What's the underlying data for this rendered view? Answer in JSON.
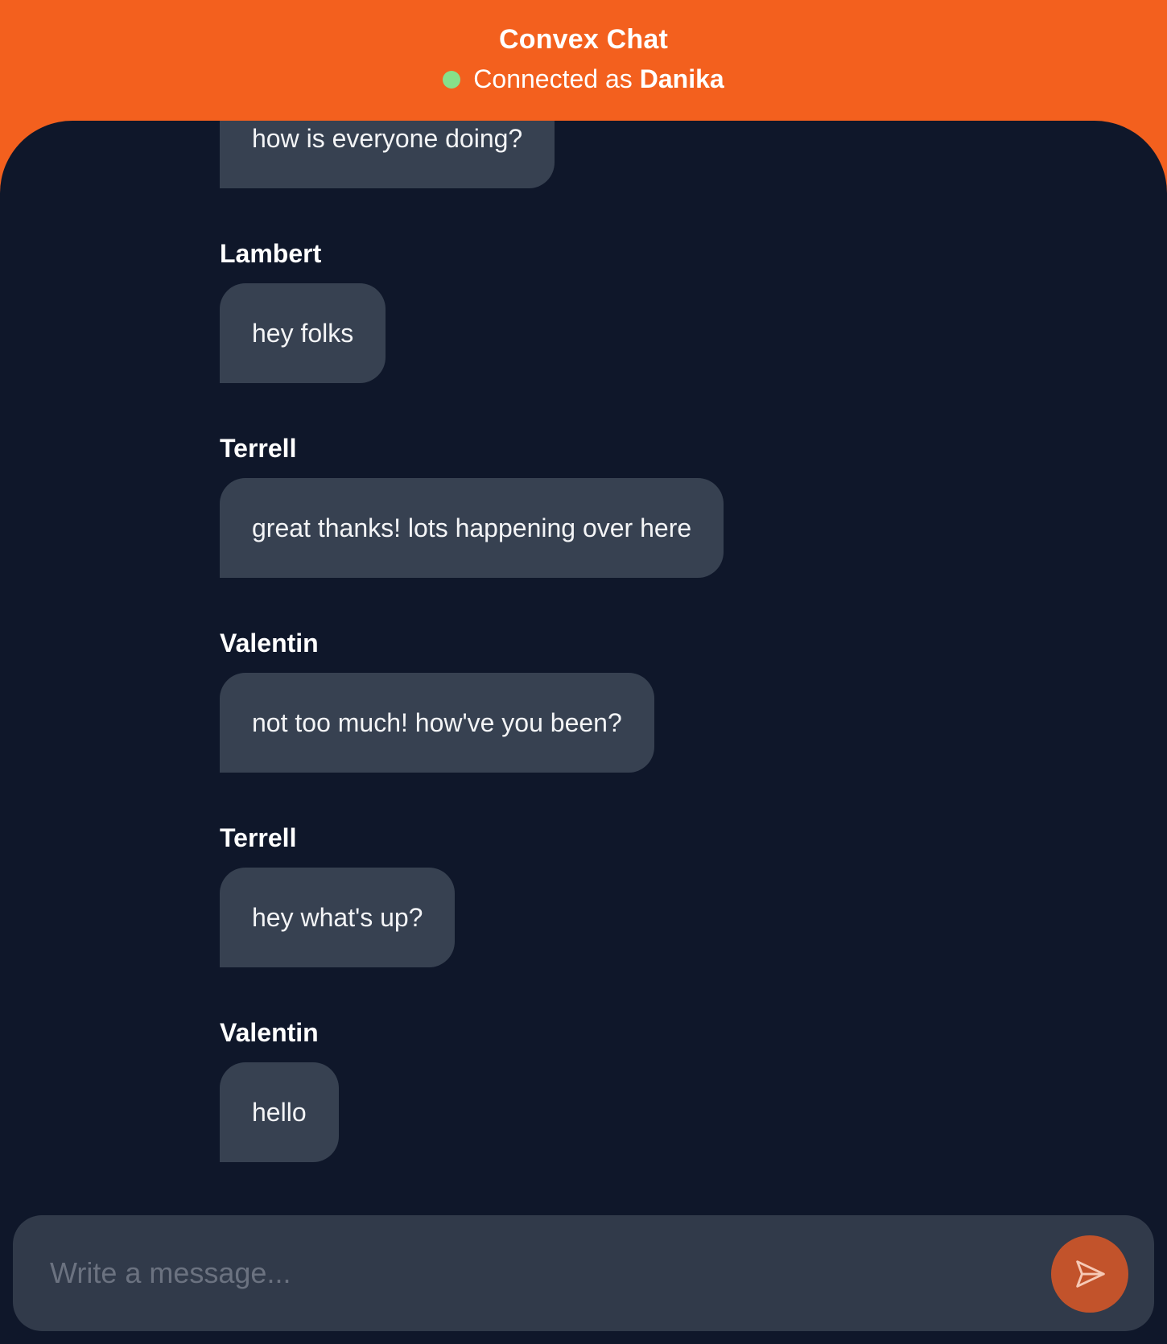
{
  "header": {
    "title": "Convex Chat",
    "status_prefix": "Connected as",
    "username": "Danika",
    "status_color": "#86E08A",
    "accent_color": "#F3601E"
  },
  "messages": [
    {
      "sender": "",
      "text": "how is everyone doing?"
    },
    {
      "sender": "Lambert",
      "text": "hey folks"
    },
    {
      "sender": "Terrell",
      "text": "great thanks! lots happening over here"
    },
    {
      "sender": "Valentin",
      "text": "not too much! how've you been?"
    },
    {
      "sender": "Terrell",
      "text": "hey what's up?"
    },
    {
      "sender": "Valentin",
      "text": "hello"
    }
  ],
  "composer": {
    "placeholder": "Write a message...",
    "value": "",
    "send_icon": "send-icon"
  }
}
